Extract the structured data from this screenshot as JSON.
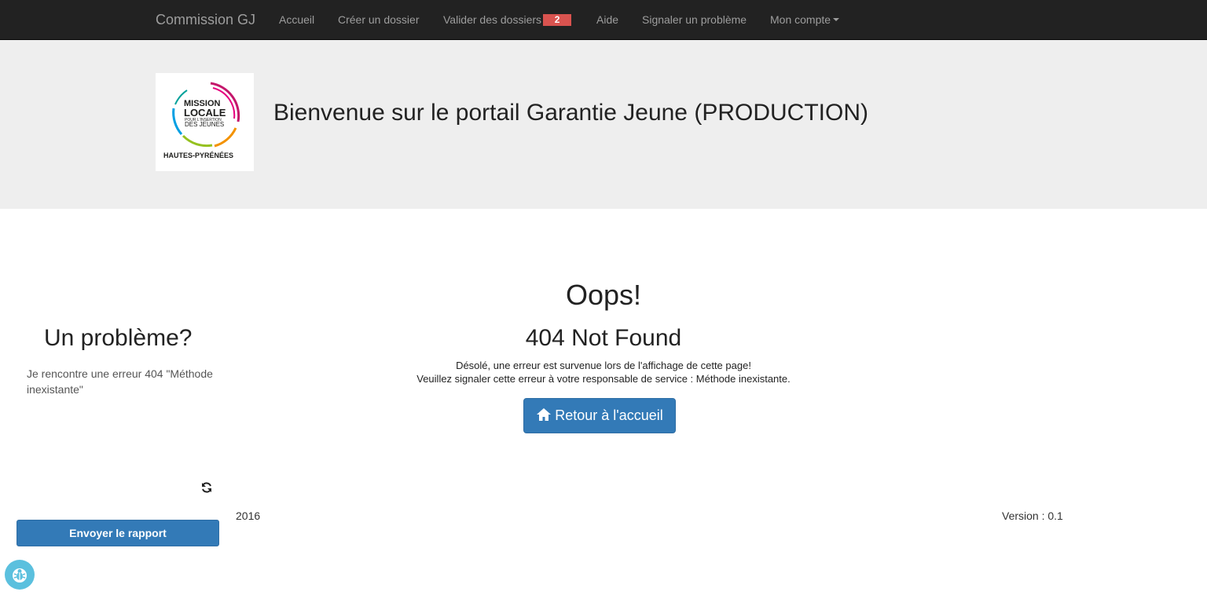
{
  "navbar": {
    "brand": "Commission GJ",
    "items": [
      {
        "label": "Accueil"
      },
      {
        "label": "Créer un dossier"
      },
      {
        "label": "Valider des dossiers",
        "badge": "2"
      },
      {
        "label": "Aide"
      },
      {
        "label": "Signaler un problème"
      },
      {
        "label": "Mon compte"
      }
    ],
    "badge_color": "#d9534f"
  },
  "header": {
    "logo": {
      "line1": "MISSION",
      "line2": "LOCALE",
      "line3": "POUR L'INSERTION",
      "line4": "DES JEUNES",
      "line5": "HAUTES-PYRÉNÉES"
    },
    "title": "Bienvenue sur le portail Garantie Jeune (PRODUCTION)"
  },
  "error": {
    "heading": "Oops!",
    "code": "404 Not Found",
    "line1": "Désolé, une erreur est survenue lors de l'affichage de cette page!",
    "line2": "Veuillez signaler cette erreur à votre responsable de service : Méthode inexistante.",
    "home_button": "Retour à l'accueil",
    "home_icon": "home-icon"
  },
  "footer": {
    "year": "2016",
    "version": "Version : 0.1"
  },
  "report_panel": {
    "title": "Un problème?",
    "text": "Je rencontre une erreur 404 \"Méthode inexistante\"",
    "refresh_icon": "refresh-icon",
    "send_button": "Envoyer le rapport",
    "bug_icon": "bug-icon"
  },
  "colors": {
    "primary": "#337ab7",
    "navbar_bg": "#222222",
    "jumbotron_bg": "#eeeeee",
    "bug_button": "#5bc0de"
  }
}
